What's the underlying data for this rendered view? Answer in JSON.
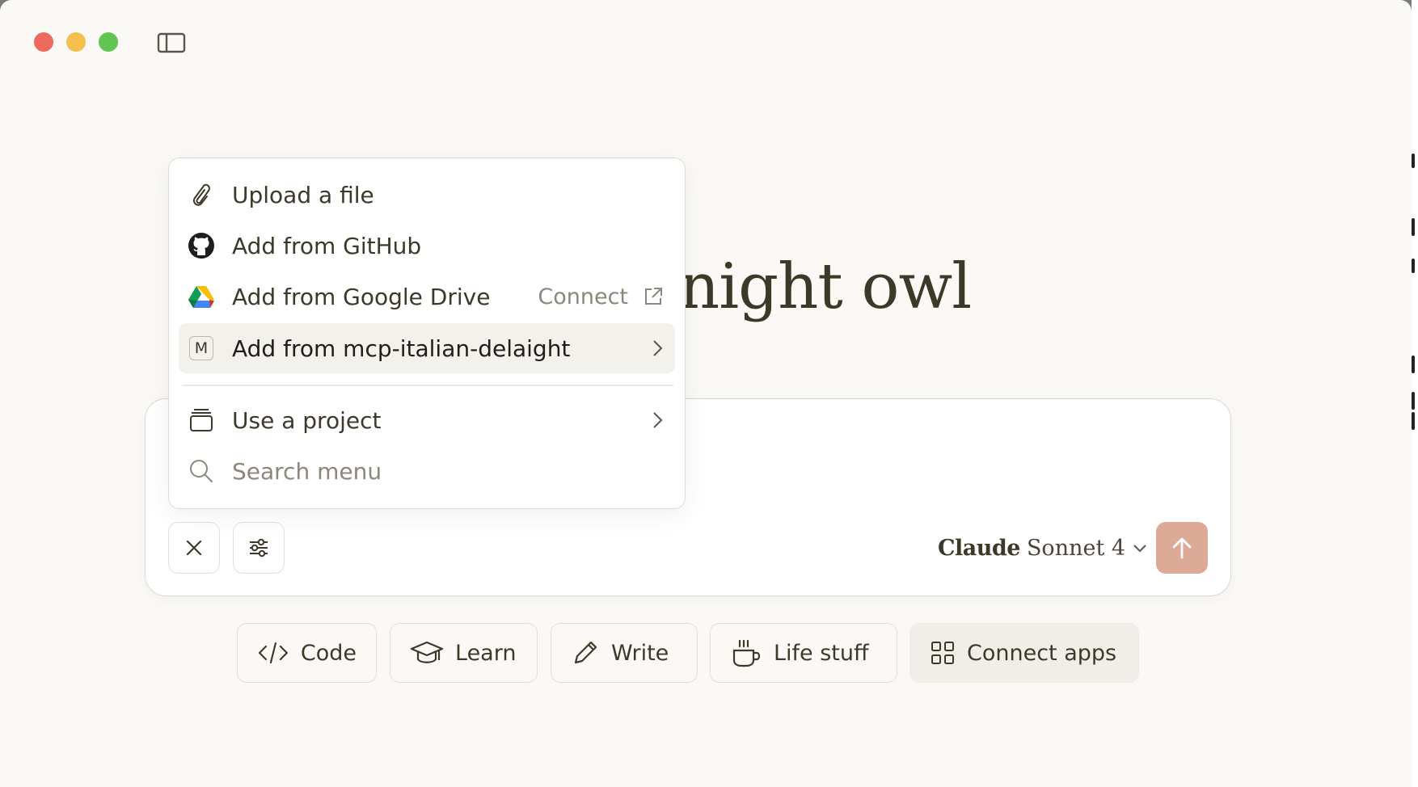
{
  "window": {
    "greeting": "night owl"
  },
  "attach_menu": {
    "items": [
      {
        "label": "Upload a file",
        "icon": "paperclip-icon"
      },
      {
        "label": "Add from GitHub",
        "icon": "github-icon"
      },
      {
        "label": "Add from Google Drive",
        "icon": "google-drive-icon",
        "action_label": "Connect",
        "action_icon": "external-link-icon"
      },
      {
        "label": "Add from mcp-italian-delaight",
        "icon": "m-badge-icon",
        "badge": "M",
        "highlighted": true
      },
      {
        "label": "Use a project",
        "icon": "project-box-icon"
      },
      {
        "label": "Search menu",
        "icon": "search-icon"
      }
    ]
  },
  "composer": {
    "model_brand": "Claude",
    "model_name": "Sonnet 4",
    "send_color": "#deaa98"
  },
  "suggestions": [
    {
      "label": "Code",
      "icon": "code-icon"
    },
    {
      "label": "Learn",
      "icon": "graduation-cap-icon"
    },
    {
      "label": "Write",
      "icon": "pencil-icon"
    },
    {
      "label": "Life stuff",
      "icon": "coffee-cup-icon"
    },
    {
      "label": "Connect apps",
      "icon": "grid-icon"
    }
  ]
}
